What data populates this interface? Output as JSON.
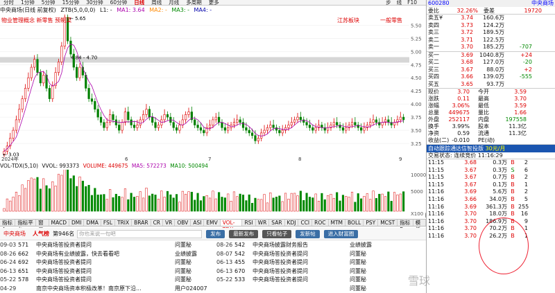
{
  "toolbar": {
    "periods": [
      "分时",
      "1分钟",
      "5分钟",
      "15分钟",
      "30分钟",
      "60分钟",
      "日线",
      "周线",
      "月线",
      "多周期",
      "更多"
    ],
    "active": "日线",
    "right_icons": [
      "步",
      "线",
      "F10"
    ]
  },
  "kline_header": {
    "name": "中央商场(日线 前复权)",
    "indicator": "ZTB(5,0,0,0)",
    "l1": "L1: -",
    "ma1": "MA1: 3.64",
    "ma2": "MA2: -",
    "ma3": "MA3: -",
    "ma4": "MA4: -"
  },
  "concepts": {
    "left": "物业管理概念 新零售 预制菜",
    "mid": "江苏板块",
    "right": "一般零售"
  },
  "kline_labels": {
    "high": "5.65",
    "range": "4.84 - 4.70",
    "low": "3.03",
    "year": "2024年",
    "month_labels": [
      "6",
      "7",
      "8",
      "9"
    ]
  },
  "y_axis": [
    "5.50",
    "5.25",
    "5.00",
    "4.75",
    "4.50",
    "4.25",
    "4.00",
    "3.75",
    "3.50",
    "3.25"
  ],
  "vol_header": {
    "title": "VOL-TDX(5,10)",
    "vvol": "VVOL: 993373",
    "volume": "VOLUME: 449675",
    "ma5": "MA5: 572273",
    "ma10": "MA10: 500494"
  },
  "vol_axis": [
    "10000",
    "5000",
    "X100"
  ],
  "indicator_tabs": [
    "指标A",
    "指标平台",
    "窗口",
    "MACD",
    "DMI",
    "DMA",
    "FSL",
    "TRIX",
    "BRAR",
    "CR",
    "VR",
    "OBV",
    "ASI",
    "EMV",
    "VOL-TDX",
    "RSI",
    "WR",
    "SAR",
    "KDJ",
    "CCI",
    "ROC",
    "MTM",
    "BOLL",
    "PSY",
    "MCST",
    "指标B",
    "模板"
  ],
  "indicator_active": "VOL-TDX",
  "day_label": "日线",
  "forum": {
    "stock_tab": "中央商场",
    "hot_tab": "人气榜",
    "rank": "第946名",
    "placeholder": "你也来说一句吧",
    "post_button": "发布",
    "newest": "最新发布",
    "only_posts": "只看帖子",
    "new_post": "发新帖",
    "enter_forum": "进入财富圈"
  },
  "posts": [
    [
      "09-03",
      "571",
      "中央商场答投资者提问",
      "问董秘",
      "08-26",
      "542",
      "中央商场披露财务报告",
      "业绩披露"
    ],
    [
      "08-26",
      "662",
      "中央商场有业绩披露，快去看看吧",
      "业绩披露",
      "08-07",
      "542",
      "中央商场答投资者提问",
      "问董秘"
    ],
    [
      "06-24",
      "692",
      "中央商场答投资者提问",
      "问董秘",
      "06-13",
      "455",
      "中央商场答投资者提问",
      "问董秘"
    ],
    [
      "06-13",
      "651",
      "中央商场答投资者提问",
      "问董秘",
      "06-13",
      "670",
      "中央商场答投资者提问",
      "问董秘"
    ],
    [
      "05-22",
      "578",
      "中央商场答投资者提问",
      "问董秘",
      "05-22",
      "533",
      "中央商场答投资者提问",
      "问董秘"
    ],
    [
      "04-29",
      "",
      "南京中央商场资本积极改革！南京原下沿...",
      "用户024007",
      "",
      "",
      "",
      "问董秘"
    ]
  ],
  "quote": {
    "code": "600280",
    "name": "中央商场",
    "webi_label": "委比",
    "webi": "32.26%",
    "weicha_label": "委差",
    "weicha": "19720",
    "asks": [
      [
        "卖五¥",
        "3.74",
        "160.6万",
        ""
      ],
      [
        "卖四",
        "3.73",
        "124.2万",
        ""
      ],
      [
        "卖三",
        "3.72",
        "189.5万",
        ""
      ],
      [
        "卖二",
        "3.71",
        "122.5万",
        ""
      ],
      [
        "卖一",
        "3.70",
        "185.2万",
        "-707"
      ]
    ],
    "bids": [
      [
        "买一",
        "3.69",
        "1040.8万",
        "+24"
      ],
      [
        "买二",
        "3.68",
        "127.0万",
        "-20"
      ],
      [
        "买三",
        "3.67",
        "88.0万",
        "+2"
      ],
      [
        "买四",
        "3.66",
        "139.0万",
        "-555"
      ],
      [
        "买五",
        "3.65",
        "93.7万",
        ""
      ]
    ],
    "stats": [
      [
        "现价",
        "3.70",
        "今开",
        "3.59"
      ],
      [
        "涨跌",
        "0.11",
        "最高",
        "3.70"
      ],
      [
        "涨幅",
        "3.06%",
        "最低",
        "3.59"
      ],
      [
        "总量",
        "449675",
        "量比",
        "1.66"
      ],
      [
        "外盘",
        "252117",
        "内盘",
        "197558"
      ],
      [
        "换手",
        "3.99%",
        "股本",
        "11.3亿"
      ],
      [
        "净资",
        "0.59",
        "流通",
        "11.3亿"
      ],
      [
        "收益(二)",
        "-0.010",
        "PE(动)",
        ""
      ]
    ],
    "ad": "自动跟踪通达信智投版",
    "ad_price": "30元/月",
    "trade_status": "交易状态: 连续竞价",
    "trade_time": "11:16:29"
  },
  "ticks": [
    [
      "11:15",
      "3.68",
      "0.3万",
      "B",
      "2"
    ],
    [
      "11:15",
      "3.67",
      "0.3万",
      "S",
      "6"
    ],
    [
      "11:15",
      "3.67",
      "0.7万",
      "B",
      "2"
    ],
    [
      "11:15",
      "3.67",
      "0.1万",
      "B",
      "1"
    ],
    [
      "11:16",
      "3.69",
      "5.6万",
      "B",
      "2"
    ],
    [
      "11:16",
      "3.66",
      "34.0万",
      "B",
      "5"
    ],
    [
      "11:16",
      "3.69",
      "361.3万",
      "B",
      "255"
    ],
    [
      "11:16",
      "3.70",
      "18.0万",
      "B",
      "16"
    ],
    [
      "11:16",
      "3.70",
      "186.9万",
      "B",
      "9"
    ],
    [
      "11:16",
      "3.70",
      "70.2万",
      "B",
      "1"
    ],
    [
      "11:16",
      "3.70",
      "26.2万",
      "B",
      "1"
    ]
  ],
  "watermark": "雪球",
  "chart_data": {
    "type": "candlestick",
    "ylim": [
      3.0,
      5.65
    ],
    "closes": [
      3.1,
      3.2,
      3.35,
      3.5,
      3.7,
      3.9,
      4.1,
      4.3,
      4.5,
      4.7,
      4.85,
      4.6,
      4.4,
      4.55,
      4.3,
      4.1,
      4.35,
      4.6,
      4.8,
      5.1,
      5.65,
      5.2,
      4.95,
      4.7,
      4.5,
      4.7,
      4.55,
      4.3,
      4.1,
      4.05,
      3.9,
      3.75,
      3.65,
      3.55,
      3.65,
      3.8,
      3.7,
      3.6,
      3.5,
      3.65,
      3.85,
      3.7,
      3.6,
      3.55,
      3.6,
      3.7,
      3.8,
      3.9,
      3.75,
      3.65,
      3.55,
      3.6,
      3.7,
      3.8,
      3.75,
      3.65,
      3.55,
      3.5,
      3.6,
      3.7,
      3.8,
      3.85,
      3.7,
      3.6,
      3.55,
      3.5,
      3.45,
      3.55,
      3.6,
      3.7,
      3.75,
      3.65,
      3.55,
      3.5,
      3.55,
      3.6,
      3.65,
      3.7,
      3.65,
      3.55,
      3.5,
      3.45,
      3.4,
      3.3,
      3.35,
      3.45,
      3.5,
      3.55,
      3.6,
      3.55,
      3.5,
      3.45,
      3.5,
      3.55,
      3.6,
      3.65,
      3.7,
      3.75,
      3.7,
      3.65,
      3.6,
      3.55,
      3.5,
      3.55,
      3.6,
      3.55,
      3.5,
      3.55,
      3.6,
      3.65,
      3.6,
      3.55,
      3.5,
      3.55,
      3.6,
      3.65,
      3.6,
      3.55,
      3.5,
      3.55,
      3.6,
      3.65,
      3.7,
      3.65,
      3.6,
      3.65,
      3.7,
      3.65,
      3.6,
      3.65,
      3.7,
      3.75,
      3.7
    ]
  }
}
